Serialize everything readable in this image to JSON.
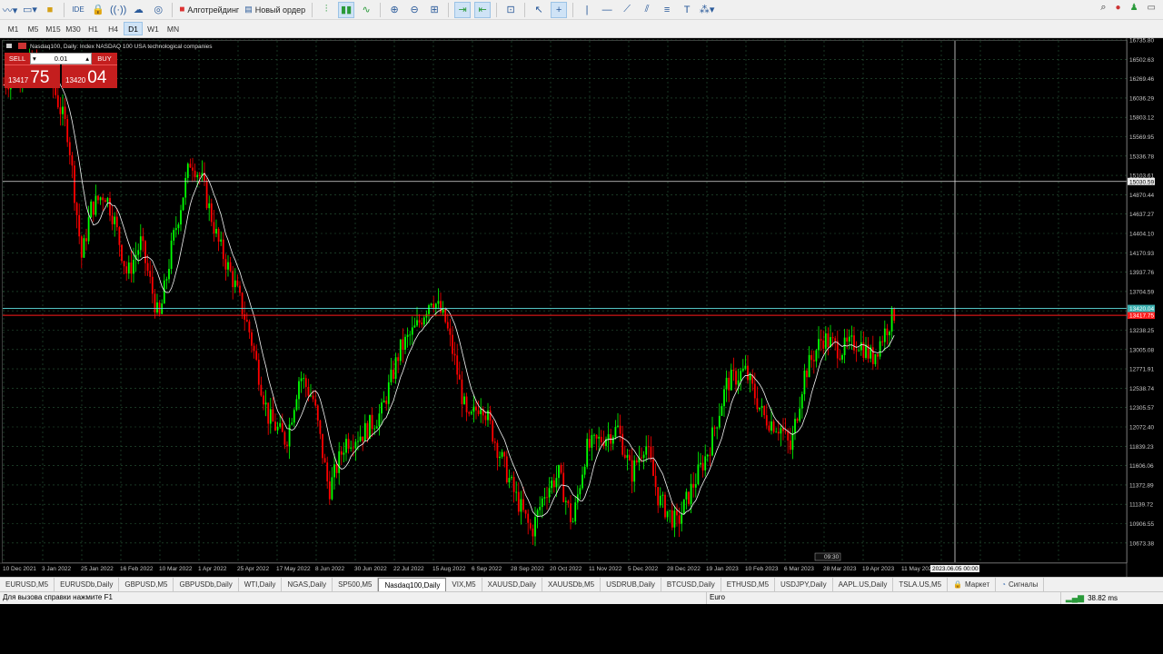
{
  "toolbar": {
    "algo_label": "Алготрейдинг",
    "new_order_label": "Новый ордер",
    "ide_label": "IDE"
  },
  "timeframes": [
    "M1",
    "M5",
    "M15",
    "M30",
    "H1",
    "H4",
    "D1",
    "W1",
    "MN"
  ],
  "active_timeframe": "D1",
  "chart": {
    "header": "Nasdaq100, Daily:  Index NASDAQ 100 USA technological companies",
    "price_axis_labels": [
      "16735.80",
      "16502.63",
      "16269.46",
      "16036.29",
      "15803.12",
      "15569.95",
      "15336.78",
      "15103.61",
      "14870.44",
      "14637.27",
      "14404.10",
      "14170.93",
      "13937.76",
      "13704.59",
      "13471.42",
      "13238.25",
      "13005.08",
      "12771.91",
      "12538.74",
      "12305.57",
      "12072.40",
      "11839.23",
      "11606.06",
      "11372.89",
      "11139.72",
      "10906.55",
      "10673.38"
    ],
    "date_axis_labels": [
      "10 Dec 2021",
      "3 Jan 2022",
      "25 Jan 2022",
      "16 Feb 2022",
      "10 Mar 2022",
      "1 Apr 2022",
      "25 Apr 2022",
      "17 May 2022",
      "8 Jun 2022",
      "30 Jun 2022",
      "22 Jul 2022",
      "15 Aug 2022",
      "6 Sep 2022",
      "28 Sep 2022",
      "20 Oct 2022",
      "11 Nov 2022",
      "5 Dec 2022",
      "28 Dec 2022",
      "19 Jan 2023",
      "10 Feb 2023",
      "6 Mar 2023",
      "28 Mar 2023",
      "19 Apr 2023",
      "11 May 2023"
    ],
    "crosshair_price": "15030.59",
    "crosshair_date": "2023.06.05 00:00",
    "bid_price": "13417.75",
    "ask_price": "13420.04",
    "time_marker": "09:30",
    "colors": {
      "background": "#000000",
      "bull": "#00ff00",
      "bear": "#ff0000",
      "grid": "#2a5a3a",
      "bid_line": "#ff1a1a",
      "ask_line": "#5fe0e0",
      "ma": "#f5f5f5",
      "axis_text": "#c8c8c8"
    }
  },
  "one_click": {
    "sell_label": "SELL",
    "buy_label": "BUY",
    "lot": "0.01",
    "sell_small": "13417",
    "sell_big": "75",
    "buy_small": "13420",
    "buy_big": "04"
  },
  "tabs": [
    "EURUSD,M5",
    "EURUSDb,Daily",
    "GBPUSD,M5",
    "GBPUSDb,Daily",
    "WTI,Daily",
    "NGAS,Daily",
    "SP500,M5",
    "Nasdaq100,Daily",
    "VIX,M5",
    "XAUUSD,Daily",
    "XAUUSDb,M5",
    "USDRUB,Daily",
    "BTCUSD,Daily",
    "ETHUSD,M5",
    "USDJPY,Daily",
    "AAPL.US,Daily",
    "TSLA.US,M5"
  ],
  "active_tab": "Nasdaq100,Daily",
  "extra_tabs": {
    "market": "Маркет",
    "signals": "Сигналы"
  },
  "status": {
    "help": "Для вызова справки нажмите F1",
    "profile": "Euro",
    "ping": "38.82 ms"
  }
}
